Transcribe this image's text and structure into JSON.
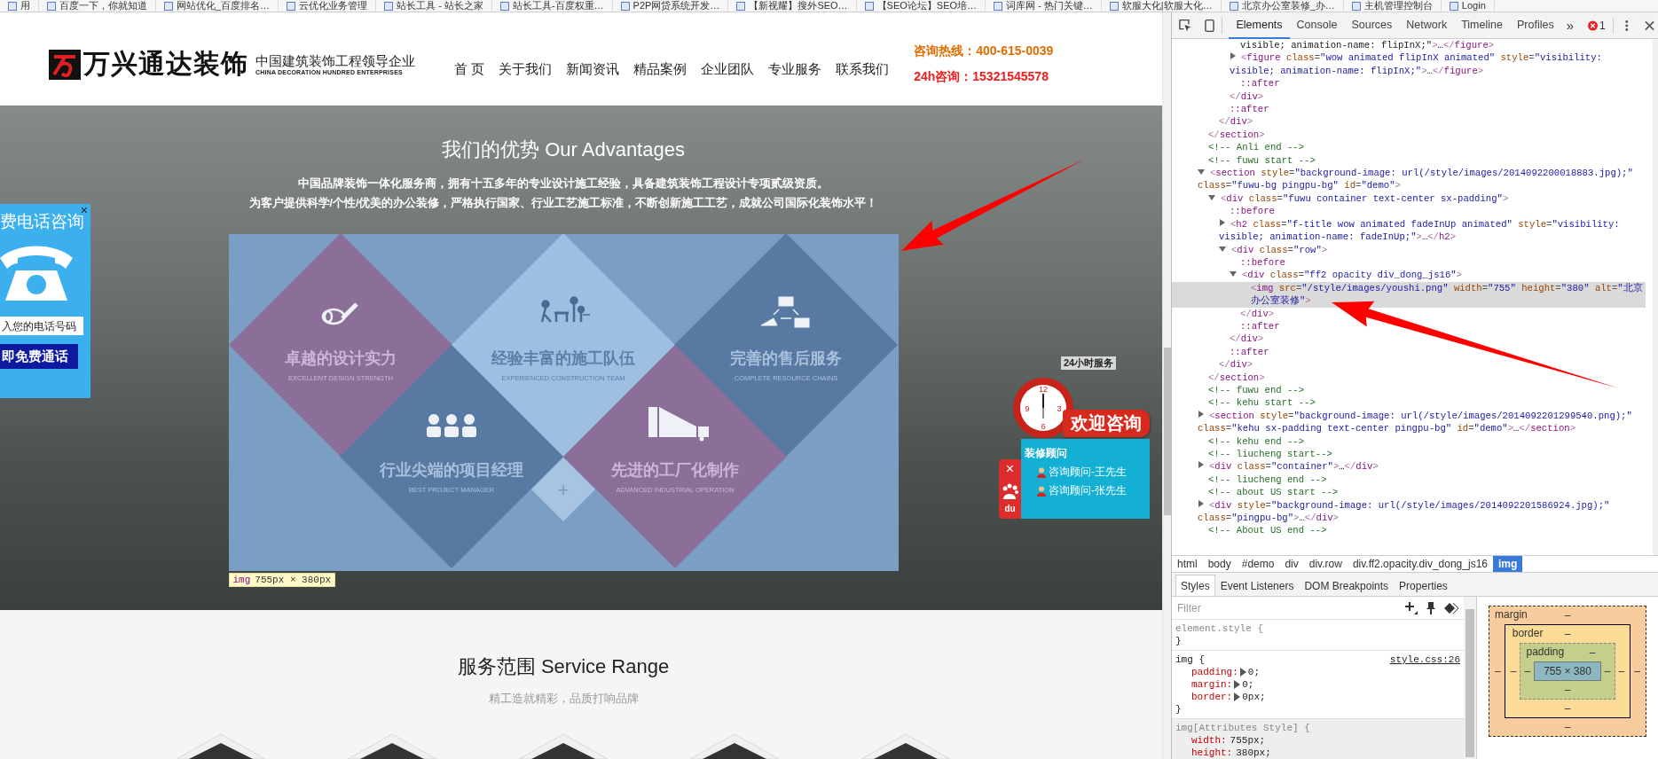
{
  "bookmarks": [
    {
      "label": "用"
    },
    {
      "label": "百度一下，你就知道"
    },
    {
      "label": "网站优化_百度排名…"
    },
    {
      "label": "云优化业务管理"
    },
    {
      "label": "站长工具 - 站长之家"
    },
    {
      "label": "站长工具-百度权重…"
    },
    {
      "label": "P2P网贷系统开发…"
    },
    {
      "label": "【新视耀】搜外SEO…"
    },
    {
      "label": "【SEO论坛】SEO培…"
    },
    {
      "label": "词库网 - 热门关键…"
    },
    {
      "label": "软服大化|软服大化…"
    },
    {
      "label": "北京办公室装修_办…"
    },
    {
      "label": "主机管理控制台"
    },
    {
      "label": "Login"
    }
  ],
  "header": {
    "logo_text": "万兴通达装饰",
    "slogan": "中国建筑装饰工程领导企业",
    "slogan_en": "CHINA DECORATION HUNDRED ENTERPRISES",
    "nav": [
      {
        "label": "首 页",
        "selected": false
      },
      {
        "label": "关于我们",
        "selected": false
      },
      {
        "label": "新闻资讯",
        "selected": false
      },
      {
        "label": "精品案例",
        "selected": false
      },
      {
        "label": "企业团队",
        "selected": false
      },
      {
        "label": "专业服务",
        "selected": false
      },
      {
        "label": "联系我们",
        "selected": false
      }
    ],
    "hotline": "咨询热线：400-615-0039",
    "mobile": "24h咨询：15321545578"
  },
  "advantages": {
    "title": "我们的优势 Our Advantages",
    "lines": [
      "中国品牌装饰一体化服务商，拥有十五多年的专业设计施工经验，具备建筑装饰工程设计专项贰级资质。",
      "为客户提供科学/个性/优美的办公装修，严格执行国家、行业工艺施工标准，不断创新施工工艺，成就公司国际化装饰水平！"
    ],
    "tiles": [
      {
        "kind": "design",
        "title": "卓越的设计实力",
        "subtitle": "EXCELLENT DESIGN STRENGTH",
        "color": "#8b6f98"
      },
      {
        "kind": "team",
        "title": "经验丰富的施工队伍",
        "subtitle": "EXPERIENCED CONSTRUCTION TEAM",
        "color": "#9dbfe2"
      },
      {
        "kind": "service",
        "title": "完善的售后服务",
        "subtitle": "COMPLETE RESOURCE CHAINS",
        "color": "#5879a2"
      },
      {
        "kind": "manager",
        "title": "行业尖端的项目经理",
        "subtitle": "BEST PROJECT MANAGER",
        "color": "#5879a2"
      },
      {
        "kind": "factory",
        "title": "先进的工厂化制作",
        "subtitle": "ADVANCED INDUSTRIAL OPERATION",
        "color": "#8b6f98"
      }
    ],
    "center_mark": "+",
    "tooltip": {
      "tag": "img",
      "size": "755px × 380px"
    }
  },
  "call_widget": {
    "title": "费电话咨询",
    "close": "×",
    "placeholder": "入您的电话号码",
    "button": "即免费通话"
  },
  "consult_widget": {
    "badge": "24小时服务",
    "clock_numbers": [
      "12",
      "3",
      "6",
      "9"
    ],
    "banner": "欢迎咨询",
    "heading": "装修顾问",
    "advisors": [
      "咨询顾问-王先生",
      "咨询顾问-张先生"
    ],
    "close": "×",
    "logo_text": "du"
  },
  "service": {
    "title": "服务范围 Service Range",
    "subtitle": "精工造就精彩，品质打响品牌"
  },
  "devtools": {
    "tabs": [
      {
        "label": "Elements",
        "selected": true
      },
      {
        "label": "Console",
        "selected": false
      },
      {
        "label": "Sources",
        "selected": false
      },
      {
        "label": "Network",
        "selected": false
      },
      {
        "label": "Timeline",
        "selected": false
      },
      {
        "label": "Profiles",
        "selected": false
      }
    ],
    "more": "»",
    "error_count": "1",
    "dom_tree": [
      {
        "selected": false,
        "close": "</section>",
        "children": [
          {
            "selected": false,
            "close": "</div>",
            "children": [
              {
                "selected": false,
                "close": "</div>",
                "children": [
                  {
                    "text": "visible; animation-name: flipInX;\">…</figure>",
                    "selected": false
                  },
                  {
                    "text": "<figure class=\"wow animated flipInX animated\" style=\"visibility: visible; animation-name: flipInX;\">…</figure>",
                    "expanded": false,
                    "selected": false
                  },
                  {
                    "text": "::after",
                    "selected": false
                  }
                ]
              },
              {
                "text": "::after",
                "selected": false
              }
            ]
          }
        ]
      },
      {
        "text": "<!-- Anli end -->",
        "selected": false
      },
      {
        "text": "<!-- fuwu start -->",
        "selected": false
      },
      {
        "text": "<section style=\"background-image: url(/style/images/2014092200018883.jpg);\" class=\"fuwu-bg pingpu-bg\" id=\"demo\">",
        "expanded": true,
        "selected": false,
        "close": "</section>",
        "children": [
          {
            "text": "<div class=\"fuwu container text-center sx-padding\">",
            "expanded": true,
            "selected": false,
            "close": "</div>",
            "children": [
              {
                "text": "::before",
                "selected": false
              },
              {
                "text": "<h2 class=\"f-title wow animated fadeInUp animated\" style=\"visibility: visible; animation-name: fadeInUp;\">…</h2>",
                "expanded": false,
                "selected": false
              },
              {
                "text": "<div class=\"row\">",
                "expanded": true,
                "selected": false,
                "close": "</div>",
                "children": [
                  {
                    "text": "::before",
                    "selected": false
                  },
                  {
                    "text": "<div class=\"ff2 opacity div_dong_js16\">",
                    "expanded": true,
                    "selected": false,
                    "close": "</div>",
                    "children": [
                      {
                        "text": "<img src=\"/style/images/youshi.png\" width=\"755\" height=\"380\" alt=\"北京办公室装修\">",
                        "selected": true
                      }
                    ]
                  },
                  {
                    "text": "::after",
                    "selected": false
                  }
                ]
              },
              {
                "text": "::after",
                "selected": false
              }
            ]
          }
        ]
      },
      {
        "text": "<!-- fuwu end -->",
        "selected": false
      },
      {
        "text": "<!-- kehu start -->",
        "selected": false
      },
      {
        "text": "<section style=\"background-image: url(/style/images/2014092201299540.png);\" class=\"kehu sx-padding text-center pingpu-bg\" id=\"demo\">…</section>",
        "expanded": false,
        "selected": false
      },
      {
        "text": "<!-- kehu end -->",
        "selected": false
      },
      {
        "text": "<!-- liucheng start-->",
        "selected": false
      },
      {
        "text": "<div class=\"container\">…</div>",
        "expanded": false,
        "selected": false
      },
      {
        "text": "<!-- liucheng end -->",
        "selected": false
      },
      {
        "text": "<!-- about US start -->",
        "selected": false
      },
      {
        "text": "<div style=\"background-image: url(/style/images/2014092201586924.jpg);\" class=\"pingpu-bg\">…</div>",
        "expanded": false,
        "selected": false
      },
      {
        "text": "<!-- About US end -->",
        "selected": false
      }
    ],
    "breadcrumbs": [
      {
        "label": "html",
        "selected": false
      },
      {
        "label": "body",
        "selected": false
      },
      {
        "label": "#demo",
        "selected": false
      },
      {
        "label": "div",
        "selected": false
      },
      {
        "label": "div.row",
        "selected": false
      },
      {
        "label": "div.ff2.opacity.div_dong_js16",
        "selected": false
      },
      {
        "label": "img",
        "selected": true
      }
    ],
    "sidebar_tabs": [
      {
        "label": "Styles",
        "selected": true
      },
      {
        "label": "Event Listeners",
        "selected": false
      },
      {
        "label": "DOM Breakpoints",
        "selected": false
      },
      {
        "label": "Properties",
        "selected": false
      }
    ],
    "styles": {
      "filter_placeholder": "Filter",
      "rules": [
        {
          "kind": "inline",
          "selector": "element.style {",
          "close": "}"
        },
        {
          "kind": "author",
          "selector": "img {",
          "source": "style.css:26",
          "close": "}",
          "properties": [
            {
              "name": "padding:",
              "value": "0;",
              "expandable": true
            },
            {
              "name": "margin:",
              "value": "0;",
              "expandable": true
            },
            {
              "name": "border:",
              "value": "0px;",
              "expandable": true
            }
          ]
        },
        {
          "kind": "attributes",
          "selector": "img[Attributes Style] {",
          "properties": [
            {
              "name": "width:",
              "value": "755px;",
              "expandable": false
            },
            {
              "name": "height:",
              "value": "380px;",
              "expandable": false
            }
          ]
        }
      ]
    },
    "box_model": {
      "margin": {
        "label": "margin",
        "top": "–",
        "right": "–",
        "bottom": "–",
        "left": "–"
      },
      "border": {
        "label": "border",
        "top": "–",
        "right": "–",
        "bottom": "–",
        "left": "–"
      },
      "padding": {
        "label": "padding",
        "top": "–",
        "right": "–",
        "bottom": "–",
        "left": "–"
      },
      "content": "755 × 380"
    }
  }
}
